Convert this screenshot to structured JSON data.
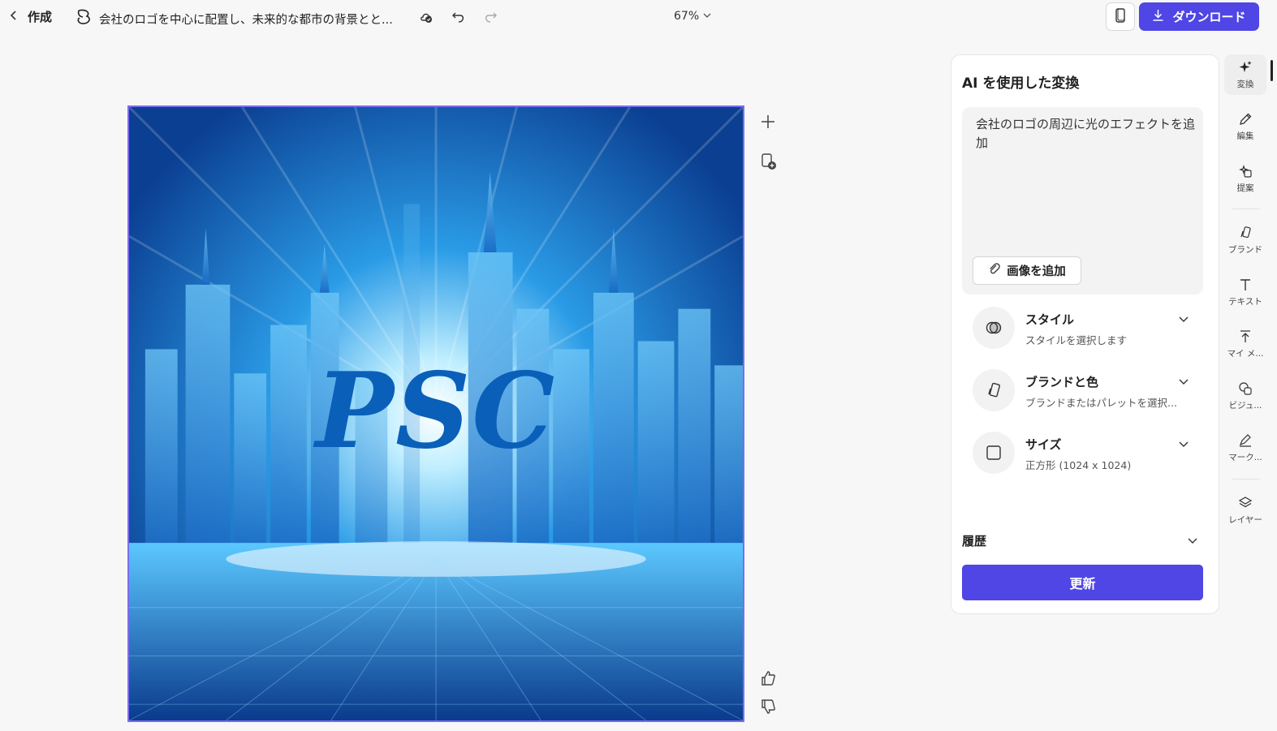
{
  "header": {
    "back_label": "作成",
    "doc_title": "会社のロゴを中心に配置し、未来的な都市の背景とと...",
    "zoom": "67%",
    "download_label": "ダウンロード"
  },
  "canvas": {
    "logo_text": "PSC"
  },
  "panel": {
    "title": "AI を使用した変換",
    "prompt": "会社のロゴの周辺に光のエフェクトを追加",
    "add_image_label": "画像を追加",
    "options": [
      {
        "label": "スタイル",
        "sub": "スタイルを選択します",
        "icon": "style-icon"
      },
      {
        "label": "ブランドと色",
        "sub": "ブランドまたはパレットを選択...",
        "icon": "brand-icon"
      },
      {
        "label": "サイズ",
        "sub": "正方形 (1024 x 1024)",
        "icon": "square-icon"
      }
    ],
    "history_label": "履歴",
    "update_label": "更新"
  },
  "rail": [
    {
      "label": "変換",
      "icon": "sparkle-icon"
    },
    {
      "label": "編集",
      "icon": "pencil-icon"
    },
    {
      "label": "提案",
      "icon": "suggest-icon"
    },
    {
      "label": "ブランド",
      "icon": "brand-icon"
    },
    {
      "label": "テキスト",
      "icon": "text-icon"
    },
    {
      "label": "マイ メ...",
      "icon": "upload-icon"
    },
    {
      "label": "ビジュ...",
      "icon": "visual-icon"
    },
    {
      "label": "マーク...",
      "icon": "markup-icon"
    },
    {
      "label": "レイヤー",
      "icon": "layers-icon"
    }
  ],
  "colors": {
    "accent": "#4f46e5",
    "canvas_border": "#7c6cf0",
    "logo_blue": "#0a5fb8"
  }
}
